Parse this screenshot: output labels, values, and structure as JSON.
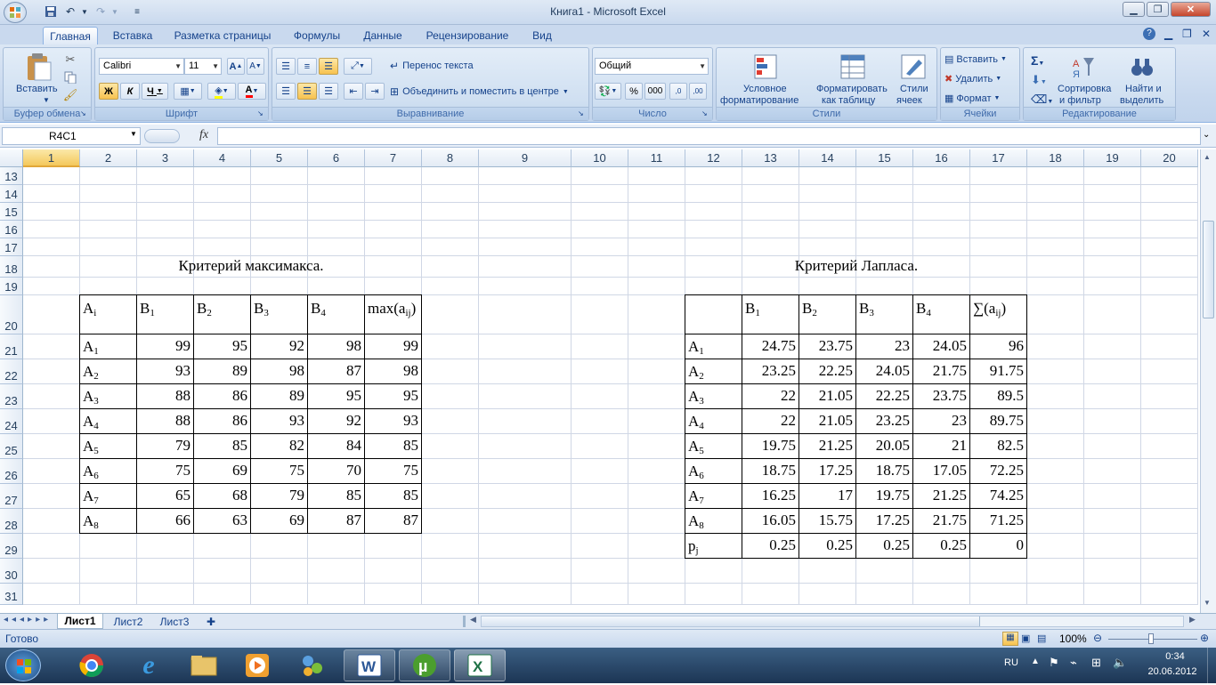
{
  "window": {
    "title": "Книга1 - Microsoft Excel"
  },
  "ribbon": {
    "tabs": [
      "Главная",
      "Вставка",
      "Разметка страницы",
      "Формулы",
      "Данные",
      "Рецензирование",
      "Вид"
    ],
    "clipboard": {
      "paste": "Вставить",
      "label": "Буфер обмена"
    },
    "font": {
      "name": "Calibri",
      "size": "11",
      "bold": "Ж",
      "italic": "К",
      "underline": "Ч",
      "label": "Шрифт"
    },
    "alignment": {
      "wrap": "Перенос текста",
      "merge": "Объединить и поместить в центре",
      "label": "Выравнивание"
    },
    "number": {
      "format": "Общий",
      "percent": "%",
      "thousands": "000",
      "label": "Число"
    },
    "styles": {
      "conditional_1": "Условное",
      "conditional_2": "форматирование",
      "table_1": "Форматировать",
      "table_2": "как таблицу",
      "cell_1": "Стили",
      "cell_2": "ячеек",
      "label": "Стили"
    },
    "cells": {
      "insert": "Вставить",
      "delete": "Удалить",
      "format": "Формат",
      "label": "Ячейки"
    },
    "editing": {
      "sort_1": "Сортировка",
      "sort_2": "и фильтр",
      "find_1": "Найти и",
      "find_2": "выделить",
      "label": "Редактирование"
    }
  },
  "formula_bar": {
    "name_box": "R4C1",
    "fx": "fx",
    "value": ""
  },
  "columns": [
    "1",
    "2",
    "3",
    "4",
    "5",
    "6",
    "7",
    "8",
    "9",
    "10",
    "11",
    "12",
    "13",
    "14",
    "15",
    "16",
    "17",
    "18",
    "19",
    "20"
  ],
  "rows": [
    "13",
    "14",
    "15",
    "16",
    "17",
    "18",
    "19",
    "20",
    "21",
    "22",
    "23",
    "24",
    "25",
    "26",
    "27",
    "28",
    "29",
    "30",
    "31"
  ],
  "maximax": {
    "title": "Критерий максимакса.",
    "headers": [
      "A",
      "B",
      "B",
      "B",
      "B",
      "max(a"
    ],
    "header_subs": [
      "i",
      "1",
      "2",
      "3",
      "4",
      "ij"
    ],
    "header_tail": [
      "",
      "",
      "",
      "",
      "",
      ")"
    ],
    "row_labels": [
      "A",
      "A",
      "A",
      "A",
      "A",
      "A",
      "A",
      "A"
    ],
    "row_subs": [
      "1",
      "2",
      "3",
      "4",
      "5",
      "6",
      "7",
      "8"
    ],
    "values": [
      [
        "99",
        "95",
        "92",
        "98",
        "99"
      ],
      [
        "93",
        "89",
        "98",
        "87",
        "98"
      ],
      [
        "88",
        "86",
        "89",
        "95",
        "95"
      ],
      [
        "88",
        "86",
        "93",
        "92",
        "93"
      ],
      [
        "79",
        "85",
        "82",
        "84",
        "85"
      ],
      [
        "75",
        "69",
        "75",
        "70",
        "75"
      ],
      [
        "65",
        "68",
        "79",
        "85",
        "85"
      ],
      [
        "66",
        "63",
        "69",
        "87",
        "87"
      ]
    ]
  },
  "laplace": {
    "title": "Критерий Лапласа.",
    "headers": [
      "",
      "B",
      "B",
      "B",
      "B",
      "∑(a"
    ],
    "header_subs": [
      "",
      "1",
      "2",
      "3",
      "4",
      "ij"
    ],
    "header_tail": [
      "",
      "",
      "",
      "",
      "",
      ")"
    ],
    "row_labels": [
      "A",
      "A",
      "A",
      "A",
      "A",
      "A",
      "A",
      "A",
      "p"
    ],
    "row_subs": [
      "1",
      "2",
      "3",
      "4",
      "5",
      "6",
      "7",
      "8",
      "j"
    ],
    "values": [
      [
        "24.75",
        "23.75",
        "23",
        "24.05",
        "96"
      ],
      [
        "23.25",
        "22.25",
        "24.05",
        "21.75",
        "91.75"
      ],
      [
        "22",
        "21.05",
        "22.25",
        "23.75",
        "89.5"
      ],
      [
        "22",
        "21.05",
        "23.25",
        "23",
        "89.75"
      ],
      [
        "19.75",
        "21.25",
        "20.05",
        "21",
        "82.5"
      ],
      [
        "18.75",
        "17.25",
        "18.75",
        "17.05",
        "72.25"
      ],
      [
        "16.25",
        "17",
        "19.75",
        "21.25",
        "74.25"
      ],
      [
        "16.05",
        "15.75",
        "17.25",
        "21.75",
        "71.25"
      ],
      [
        "0.25",
        "0.25",
        "0.25",
        "0.25",
        "0"
      ]
    ]
  },
  "sheets": [
    "Лист1",
    "Лист2",
    "Лист3"
  ],
  "status": {
    "ready": "Готово",
    "zoom": "100%"
  },
  "tray": {
    "lang": "RU",
    "time": "0:34",
    "date": "20.06.2012"
  }
}
